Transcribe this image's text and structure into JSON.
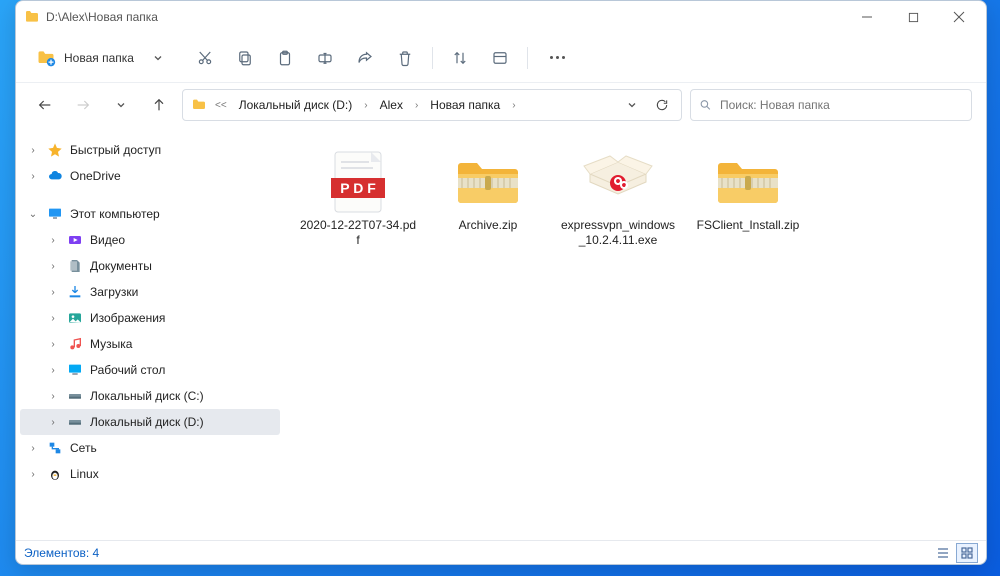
{
  "window": {
    "title": "D:\\Alex\\Новая папка"
  },
  "toolbar": {
    "new_label": "Новая папка"
  },
  "breadcrumbs": {
    "root": "Локальный диск (D:)",
    "mid": "Alex",
    "leaf": "Новая папка"
  },
  "search": {
    "placeholder": "Поиск: Новая папка"
  },
  "sidebar": {
    "quick_access": "Быстрый доступ",
    "onedrive": "OneDrive",
    "this_pc": "Этот компьютер",
    "videos": "Видео",
    "documents": "Документы",
    "downloads": "Загрузки",
    "pictures": "Изображения",
    "music": "Музыка",
    "desktop": "Рабочий стол",
    "drive_c": "Локальный диск (C:)",
    "drive_d": "Локальный диск (D:)",
    "network": "Сеть",
    "linux": "Linux"
  },
  "files": {
    "f0": "2020-12-22T07-34.pdf",
    "f1": "Archive.zip",
    "f2": "expressvpn_windows_10.2.4.11.exe",
    "f3": "FSClient_Install.zip"
  },
  "status": {
    "text": "Элементов: 4"
  }
}
